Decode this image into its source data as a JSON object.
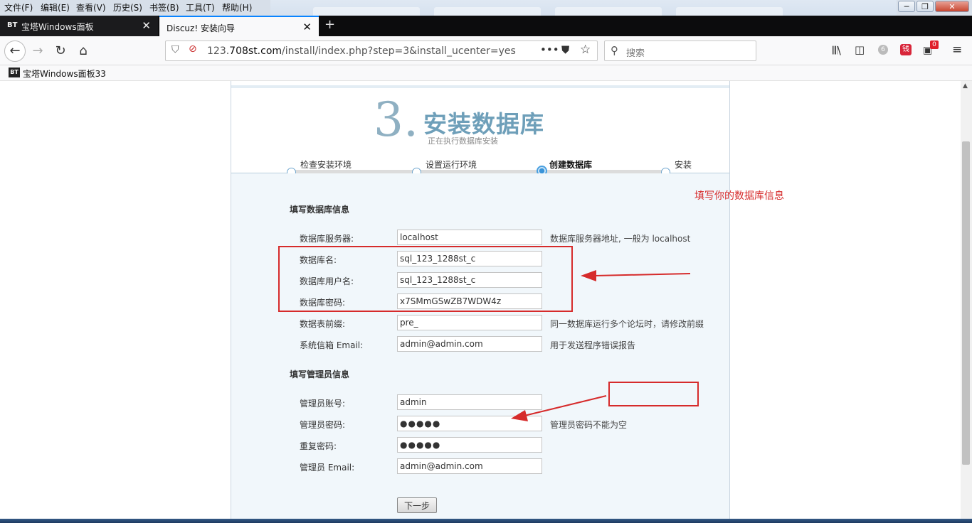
{
  "menubar": {
    "items": [
      "文件(F)",
      "编辑(E)",
      "查看(V)",
      "历史(S)",
      "书签(B)",
      "工具(T)",
      "帮助(H)"
    ]
  },
  "tabs": [
    {
      "icon": "BT",
      "title": "宝塔Windows面板"
    },
    {
      "title": "Discuz! 安装向导"
    }
  ],
  "navbar": {
    "url_prefix": "123.",
    "url_domain": "708st.com",
    "url_path": "/install/index.php?step=3&install_ucenter=yes",
    "search_placeholder": "搜索",
    "notification_count": "0",
    "badge_number": "6"
  },
  "bookmarks": [
    {
      "icon": "BT",
      "label": "宝塔Windows面板33"
    }
  ],
  "install": {
    "step_number": "3.",
    "step_title": "安装数据库",
    "step_subtitle": "正在执行数据库安装",
    "steps": [
      "检查安装环境",
      "设置运行环境",
      "创建数据库",
      "安装"
    ],
    "current_step_index": 2,
    "db_section_title": "填写数据库信息",
    "db_fields": [
      {
        "label": "数据库服务器:",
        "value": "localhost",
        "hint": "数据库服务器地址, 一般为 localhost"
      },
      {
        "label": "数据库名:",
        "value": "sql_123_1288st_c",
        "hint": ""
      },
      {
        "label": "数据库用户名:",
        "value": "sql_123_1288st_c",
        "hint": ""
      },
      {
        "label": "数据库密码:",
        "value": "x7SMmGSwZB7WDW4z",
        "hint": ""
      },
      {
        "label": "数据表前缀:",
        "value": "pre_",
        "hint": "同一数据库运行多个论坛时，请修改前缀"
      },
      {
        "label": "系统信箱 Email:",
        "value": "admin@admin.com",
        "hint": "用于发送程序错误报告"
      }
    ],
    "admin_section_title": "填写管理员信息",
    "admin_fields": [
      {
        "label": "管理员账号:",
        "value": "admin",
        "hint": ""
      },
      {
        "label": "管理员密码:",
        "value": "●●●●●",
        "hint": "管理员密码不能为空"
      },
      {
        "label": "重复密码:",
        "value": "●●●●●",
        "hint": ""
      },
      {
        "label": "管理员 Email:",
        "value": "admin@admin.com",
        "hint": ""
      }
    ],
    "next_label": "下一步"
  },
  "annotation": {
    "note": "填写你的数据库信息",
    "color": "#d62b2b"
  },
  "colors": {
    "accent": "#0a84ff",
    "step_title": "#6e9fb9",
    "form_bg": "#f1f7fb"
  }
}
